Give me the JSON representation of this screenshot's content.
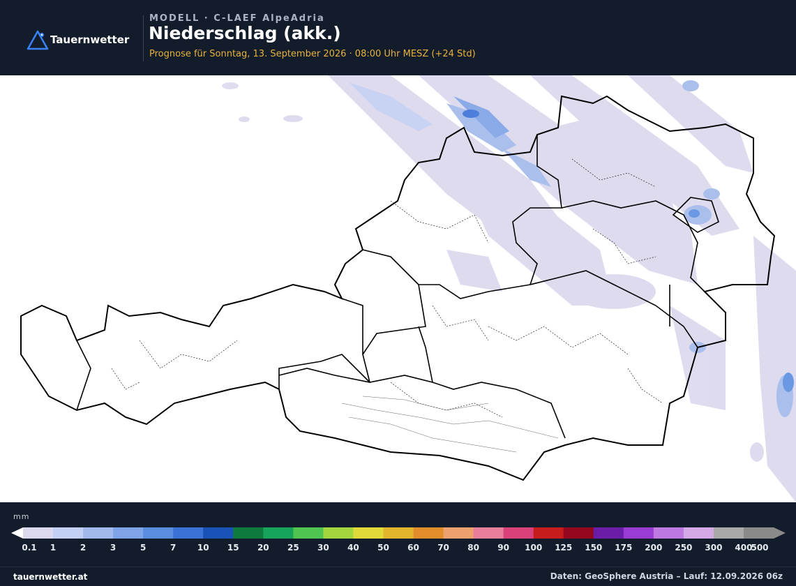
{
  "header": {
    "logo_text": "Tauernwetter",
    "model": "MODELL · C-LAEF AlpeAdria",
    "title": "Niederschlag (akk.)",
    "subtitle": "Prognose für Sonntag, 13. September 2026 · 08:00 Uhr MESZ  (+24 Std)"
  },
  "legend": {
    "unit": "mm",
    "ticks": [
      "0.1",
      "1",
      "2",
      "3",
      "5",
      "7",
      "10",
      "15",
      "20",
      "25",
      "30",
      "40",
      "50",
      "60",
      "70",
      "80",
      "90",
      "100",
      "125",
      "150",
      "175",
      "200",
      "250",
      "300",
      "400",
      "500"
    ],
    "colors": [
      "#dcd8ee",
      "#c3cff3",
      "#a2b9ec",
      "#7ea3e6",
      "#5a8de0",
      "#3a72d6",
      "#1a53b8",
      "#0e7a3c",
      "#17a35a",
      "#4fc451",
      "#a3d63c",
      "#e0d93a",
      "#e2b52c",
      "#e38c2c",
      "#eda26e",
      "#e87d9c",
      "#d9417a",
      "#c61c1c",
      "#95071c",
      "#6a1ea8",
      "#9a3bd3",
      "#bd78e2",
      "#d3aae6",
      "#a9a9a9",
      "#8a8a8a"
    ]
  },
  "footer": {
    "site": "tauernwetter.at",
    "source": "Daten: GeoSphere Austria – Lauf: 12.09.2026 06z"
  },
  "colors": {
    "background": "#131c2b",
    "accent": "#e8b33c",
    "logo_blue": "#3b82f6"
  },
  "icons": [
    "triangle-logo-icon"
  ]
}
